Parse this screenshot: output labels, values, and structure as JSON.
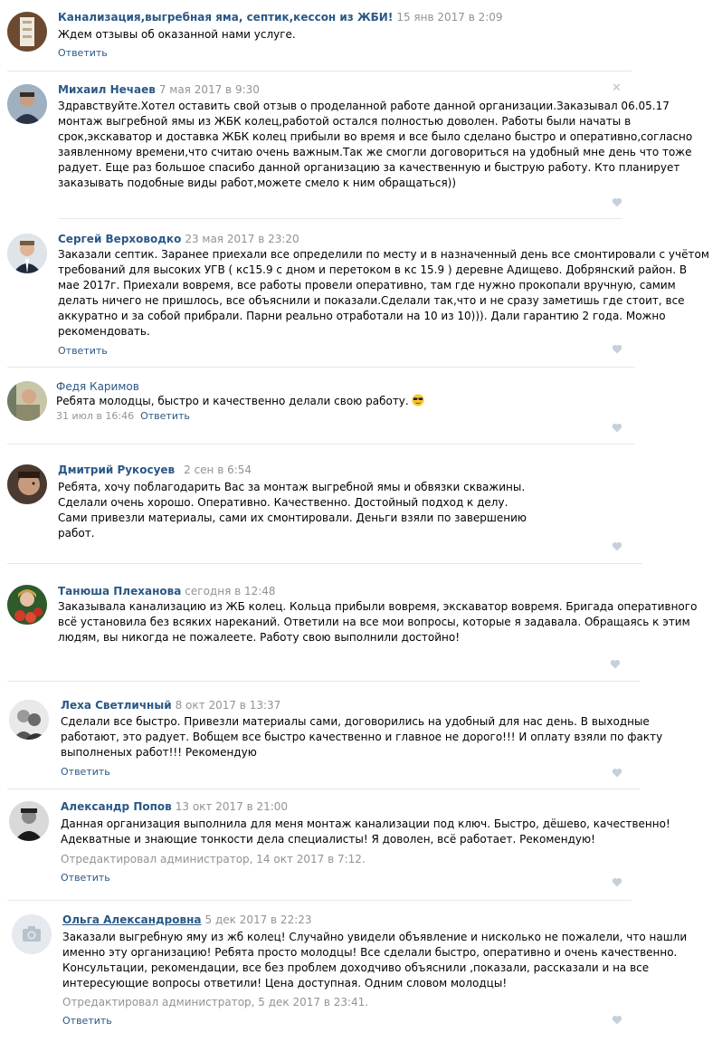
{
  "colors": {
    "link": "#2a5885",
    "muted": "#939393",
    "separator": "#e7e8ec",
    "heart": "#c5d0db"
  },
  "icons": {
    "like": "heart-icon",
    "delete": "close-icon",
    "no_photo": "camera-icon"
  },
  "posts": [
    {
      "author": "Канализация,выгребная яма, септик,кессон из ЖБИ!",
      "date": "15 янв 2017 в 2:09",
      "lines": [
        "Ждем отзывы об оказанной нами услуге."
      ],
      "reply": "Ответить"
    },
    {
      "author": "Михаил Нечаев",
      "date": "7 мая 2017 в 9:30",
      "close": "✕",
      "lines": [
        "Здравствуйте.Хотел оставить свой отзыв о проделанной работе данной организации.Заказывал 06.05.17",
        "монтаж выгребной ямы из ЖБК колец,работой остался полностью доволен. Работы были начаты в",
        "срок,экскаватор и доставка ЖБК колец прибыли во время и все было сделано быстро и оперативно,согласно",
        "заявленному времени,что считаю очень важным.Так же смогли договориться на удобный мне день что тоже",
        "радует. Еще раз большое спасибо данной организацию за качественную и быструю работу. Кто планирует",
        "заказывать подобные виды работ,можете смело к ним обращаться))"
      ]
    },
    {
      "author": "Сергей Верховодко",
      "date": "23 мая 2017 в 23:20",
      "lines": [
        "Заказали септик. Заранее приехали все определили по месту и в назначенный день все смонтировали с учётом",
        "требований для высоких УГВ ( кс15.9 с дном и перетоком в кс 15.9 ) деревне Адищево. Добрянский район. В",
        "мае 2017г. Приехали вовремя, все работы провели оперативно, там где нужно прокопали вручную, самим",
        "делать ничего не пришлось, все объяснили и показали.Сделали так,что и не сразу заметишь где стоит, все",
        "аккуратно и за собой прибрали. Парни реально отработали на 10 из 10))). Дали гарантию 2 года. Можно",
        "рекомендовать."
      ],
      "reply": "Ответить"
    },
    {
      "author": "Федя Каримов",
      "lines": [
        "Ребята молодцы, быстро и качественно делали свою работу."
      ],
      "emoji": "sunglasses-emoji",
      "date": "31 июл в 16:46",
      "reply": "Ответить"
    },
    {
      "author": "Дмитрий Рукосуев",
      "date": "2 сен в 6:54",
      "lines": [
        "Ребята, хочу поблагодарить Вас за монтаж выгребной ямы и обвязки скважины.",
        "Сделали очень хорошо. Оперативно. Качественно. Достойный подход к делу.",
        "Сами привезли материалы, сами их смонтировали. Деньги взяли по завершению",
        "работ."
      ]
    },
    {
      "author": "Танюша Плеханова",
      "date": "сегодня в 12:48",
      "lines": [
        "Заказывала канализацию из ЖБ колец. Кольца прибыли вовремя, экскаватор вовремя. Бригада оперативного",
        "всё установила без всяких нареканий. Ответили на все мои вопросы, которые я задавала. Обращаясь к этим",
        "людям, вы никогда не пожалеете. Работу свою выполнили достойно!"
      ]
    },
    {
      "author": "Леха Светличный",
      "date": "8 окт 2017 в 13:37",
      "lines": [
        "Сделали все быстро. Привезли материалы сами, договорились на удобный для нас день. В выходные",
        "работают, это радует. Вобщем все быстро качественно и главное не дорого!!! И оплату взяли по факту",
        "выполненых работ!!! Рекомендую"
      ],
      "reply": "Ответить"
    },
    {
      "author": "Александр Попов",
      "date": "13 окт 2017 в 21:00",
      "lines": [
        "Данная организация выполнила для меня монтаж канализации под ключ. Быстро, дёшево, качественно!",
        "Адекватные и знающие тонкости дела специалисты! Я доволен, всё работает. Рекомендую!"
      ],
      "edited": "Отредактировал администратор, 14 окт 2017 в 7:12.",
      "reply": "Ответить"
    },
    {
      "author": "Ольга Александровна",
      "date": "5 дек 2017 в 22:23",
      "lines": [
        "Заказали выгребную яму из жб колец! Случайно увидели объявление и нисколько не пожалели, что нашли",
        "именно эту организацию! Ребята просто молодцы! Все сделали быстро, оперативно и очень качественно.",
        "Консультации, рекомендации, все без проблем доходчиво объяснили ,показали, рассказали и на все",
        "интересующие вопросы ответили! Цена доступная. Одним словом молодцы!"
      ],
      "edited": "Отредактировал администратор, 5 дек 2017 в 23:41.",
      "reply": "Ответить"
    }
  ]
}
